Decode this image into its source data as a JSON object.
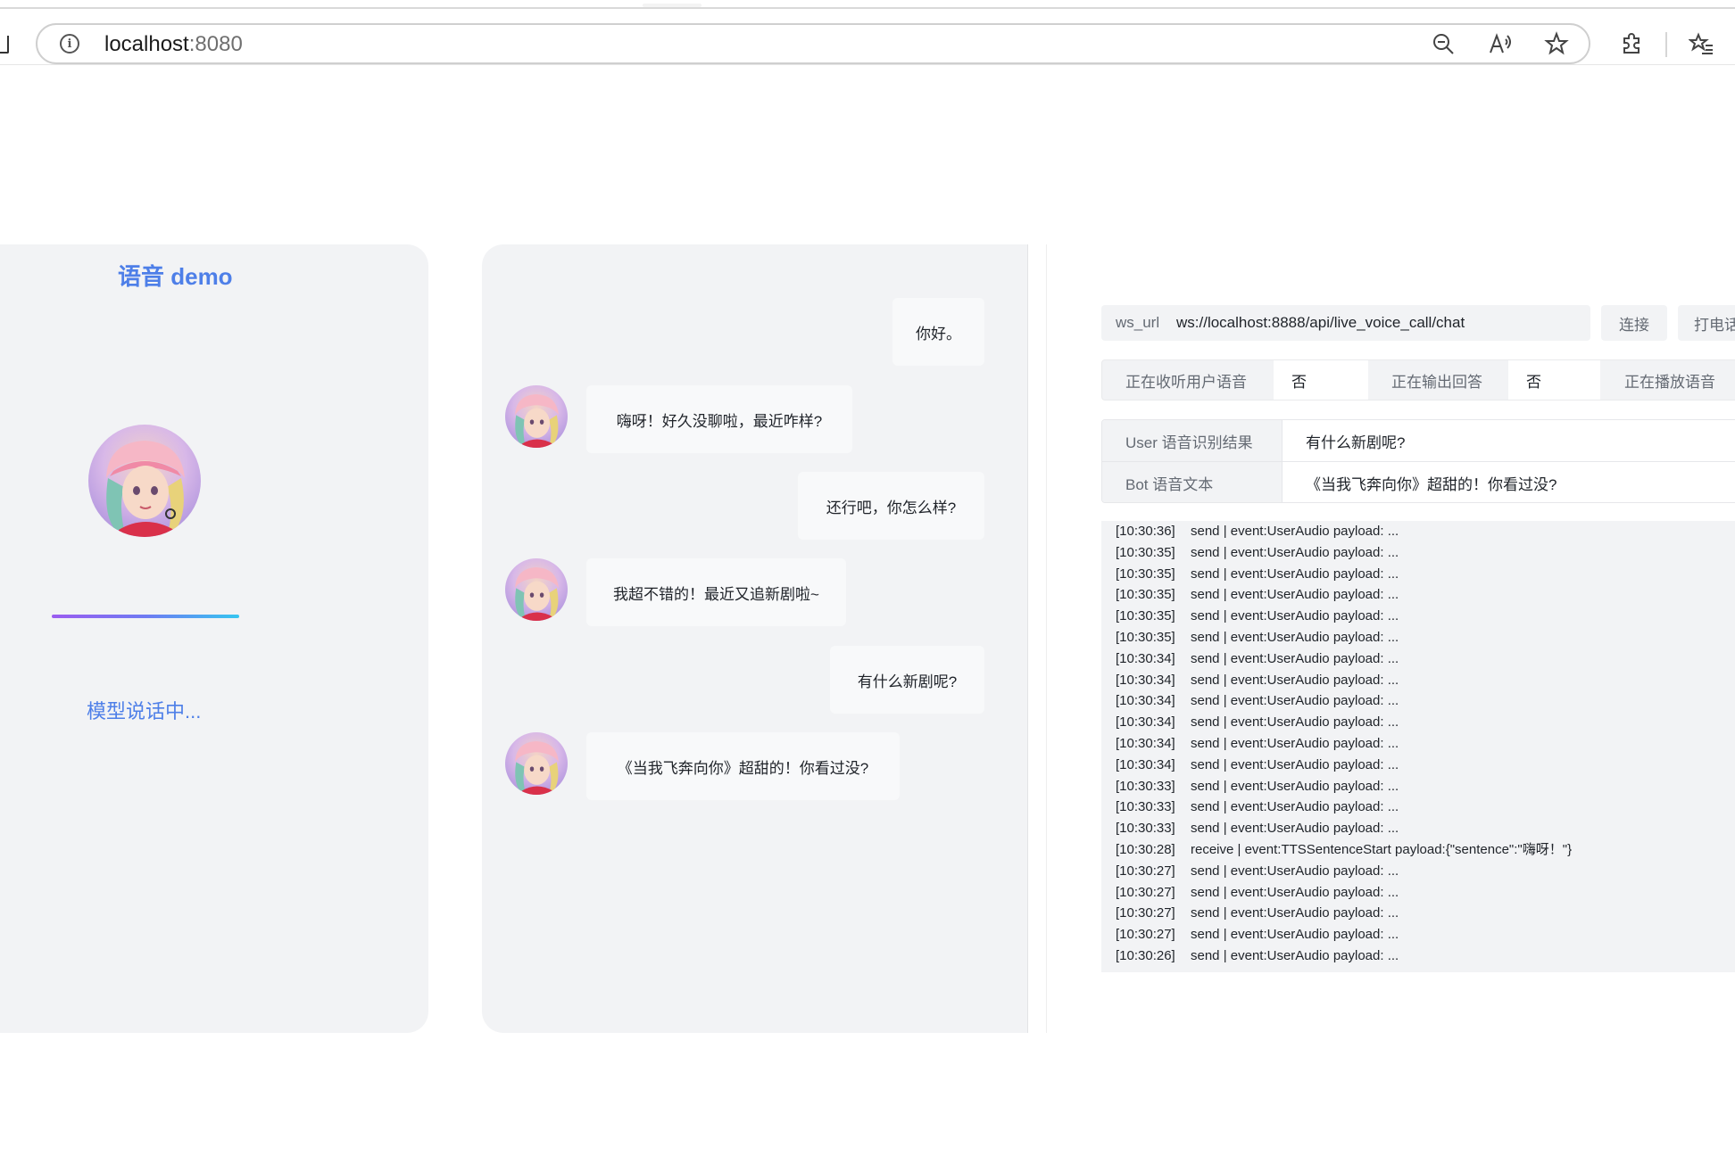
{
  "browser": {
    "url_host": "localhost",
    "url_port": ":8080"
  },
  "left": {
    "title": "语音 demo",
    "status_text": "模型说话中..."
  },
  "chat": [
    {
      "role": "user",
      "text": "你好。"
    },
    {
      "role": "bot",
      "text": "嗨呀！好久没聊啦，最近咋样?"
    },
    {
      "role": "user",
      "text": "还行吧，你怎么样?"
    },
    {
      "role": "bot",
      "text": "我超不错的！最近又追新剧啦~"
    },
    {
      "role": "user",
      "text": "有什么新剧呢?"
    },
    {
      "role": "bot",
      "text": "《当我飞奔向你》超甜的！你看过没?"
    }
  ],
  "controls": {
    "ws_label": "ws_url",
    "ws_value": "ws://localhost:8888/api/live_voice_call/chat",
    "connect_label": "连接",
    "call_label": "打电话"
  },
  "status": {
    "listening_label": "正在收听用户语音",
    "listening_value": "否",
    "outputting_label": "正在输出回答",
    "outputting_value": "否",
    "playing_label": "正在播放语音"
  },
  "results": {
    "user_label": "User 语音识别结果",
    "user_value": "有什么新剧呢?",
    "bot_label": "Bot 语音文本",
    "bot_value": "《当我飞奔向你》超甜的！你看过没?"
  },
  "logs": [
    {
      "time": "[10:30:36]",
      "msg": "send | event:UserAudio payload: ..."
    },
    {
      "time": "[10:30:35]",
      "msg": "send | event:UserAudio payload: ..."
    },
    {
      "time": "[10:30:35]",
      "msg": "send | event:UserAudio payload: ..."
    },
    {
      "time": "[10:30:35]",
      "msg": "send | event:UserAudio payload: ..."
    },
    {
      "time": "[10:30:35]",
      "msg": "send | event:UserAudio payload: ..."
    },
    {
      "time": "[10:30:35]",
      "msg": "send | event:UserAudio payload: ..."
    },
    {
      "time": "[10:30:34]",
      "msg": "send | event:UserAudio payload: ..."
    },
    {
      "time": "[10:30:34]",
      "msg": "send | event:UserAudio payload: ..."
    },
    {
      "time": "[10:30:34]",
      "msg": "send | event:UserAudio payload: ..."
    },
    {
      "time": "[10:30:34]",
      "msg": "send | event:UserAudio payload: ..."
    },
    {
      "time": "[10:30:34]",
      "msg": "send | event:UserAudio payload: ..."
    },
    {
      "time": "[10:30:34]",
      "msg": "send | event:UserAudio payload: ..."
    },
    {
      "time": "[10:30:33]",
      "msg": "send | event:UserAudio payload: ..."
    },
    {
      "time": "[10:30:33]",
      "msg": "send | event:UserAudio payload: ..."
    },
    {
      "time": "[10:30:33]",
      "msg": "send | event:UserAudio payload: ..."
    },
    {
      "time": "[10:30:28]",
      "msg": "receive | event:TTSSentenceStart payload:{\"sentence\":\"嗨呀！\"}"
    },
    {
      "time": "[10:30:27]",
      "msg": "send | event:UserAudio payload: ..."
    },
    {
      "time": "[10:30:27]",
      "msg": "send | event:UserAudio payload: ..."
    },
    {
      "time": "[10:30:27]",
      "msg": "send | event:UserAudio payload: ..."
    },
    {
      "time": "[10:30:27]",
      "msg": "send | event:UserAudio payload: ..."
    },
    {
      "time": "[10:30:26]",
      "msg": "send | event:UserAudio payload: ..."
    }
  ]
}
